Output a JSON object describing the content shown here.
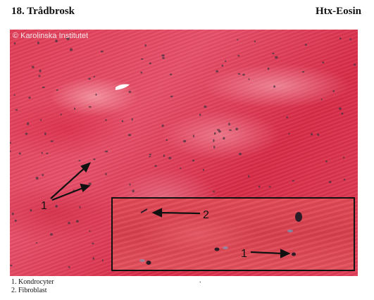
{
  "header": {
    "title": "18. Trådbrosk",
    "stain": "Htx-Eosin"
  },
  "figure": {
    "copyright": "© Karolinska Institutet",
    "main_arrow_label": "1",
    "inset": {
      "label_fibroblast": "2",
      "label_chondrocyte": "1"
    }
  },
  "legend": {
    "items": [
      "1. Kondrocyter",
      "2. Fibroblast"
    ],
    "stray_mark": "."
  },
  "colors": {
    "tissue_red": "#e23d57",
    "inset_red": "#d9404e",
    "nucleus": "#3a2a3a",
    "arrow": "#111111"
  }
}
